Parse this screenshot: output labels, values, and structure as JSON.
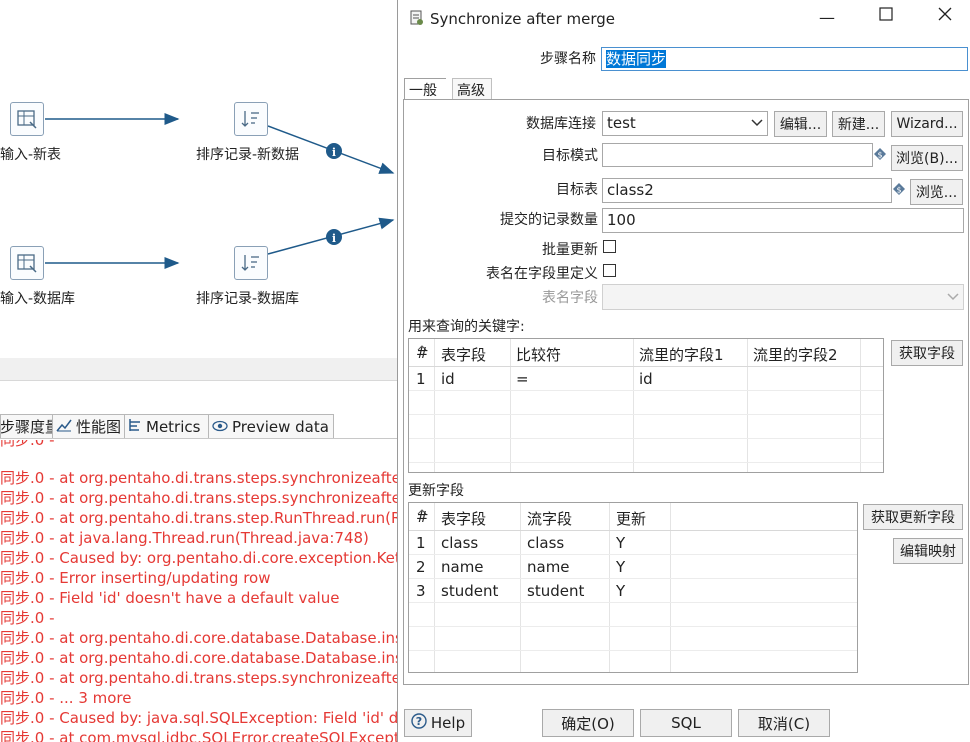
{
  "canvas": {
    "nodes": [
      {
        "label": "输入-新表"
      },
      {
        "label": "排序记录-新数据"
      },
      {
        "label": "输入-数据库"
      },
      {
        "label": "排序记录-数据库"
      }
    ]
  },
  "bottom_tabs": [
    {
      "label": "步骤度量"
    },
    {
      "label": "性能图"
    },
    {
      "label": "Metrics"
    },
    {
      "label": "Preview data"
    }
  ],
  "log_lines": [
    "同步.0 -",
    "同步.0 -  at org.pentaho.di.trans.steps.synchronizeafter",
    "同步.0 -  at org.pentaho.di.trans.steps.synchronizeafter",
    "同步.0 -  at org.pentaho.di.trans.step.RunThread.run(Ru",
    "同步.0 -  at java.lang.Thread.run(Thread.java:748)",
    "同步.0 - Caused by: org.pentaho.di.core.exception.Kett",
    "同步.0 - Error inserting/updating row",
    "同步.0 - Field 'id' doesn't have a default value",
    "同步.0 -",
    "同步.0 -  at org.pentaho.di.core.database.Database.inse",
    "同步.0 -  at org.pentaho.di.core.database.Database.inse",
    "同步.0 -  at org.pentaho.di.trans.steps.synchronizeafter",
    "同步.0 -  ... 3 more",
    "同步.0 - Caused by: java.sql.SQLException: Field 'id' doe",
    "同步.0 -  at com.mysql.jdbc.SQLError.createSQLExcepti"
  ],
  "dialog": {
    "title": "Synchronize after merge",
    "step_name_label": "步骤名称",
    "step_name_value": "数据同步",
    "tabs": [
      "一般",
      "高级"
    ],
    "db_conn_label": "数据库连接",
    "db_conn_value": "test",
    "edit_btn": "编辑...",
    "new_btn": "新建...",
    "wizard_btn": "Wizard...",
    "target_schema_label": "目标模式",
    "target_schema_value": "",
    "browse_b_btn": "浏览(B)...",
    "target_table_label": "目标表",
    "target_table_value": "class2",
    "browse_btn": "浏览...",
    "commit_label": "提交的记录数量",
    "commit_value": "100",
    "batch_label": "批量更新",
    "table_in_field_label": "表名在字段里定义",
    "table_field_label": "表名字段",
    "keys_label": "用来查询的关键字:",
    "keys_headers": [
      "#",
      "表字段",
      "比较符",
      "流里的字段1",
      "流里的字段2"
    ],
    "keys_rows": [
      [
        "1",
        "id",
        "=",
        "id",
        ""
      ]
    ],
    "get_fields_btn": "获取字段",
    "update_label": "更新字段",
    "update_headers": [
      "#",
      "表字段",
      "流字段",
      "更新"
    ],
    "update_rows": [
      [
        "1",
        "class",
        "class",
        "Y"
      ],
      [
        "2",
        "name",
        "name",
        "Y"
      ],
      [
        "3",
        "student",
        "student",
        "Y"
      ]
    ],
    "get_update_fields_btn": "获取更新字段",
    "edit_mapping_btn": "编辑映射",
    "help_btn": "Help",
    "ok_btn": "确定(O)",
    "sql_btn": "SQL",
    "cancel_btn": "取消(C)"
  },
  "colors": {
    "log_error": "#e53935",
    "hop_arrow": "#1f5a8a",
    "selection": "#0078d7"
  }
}
